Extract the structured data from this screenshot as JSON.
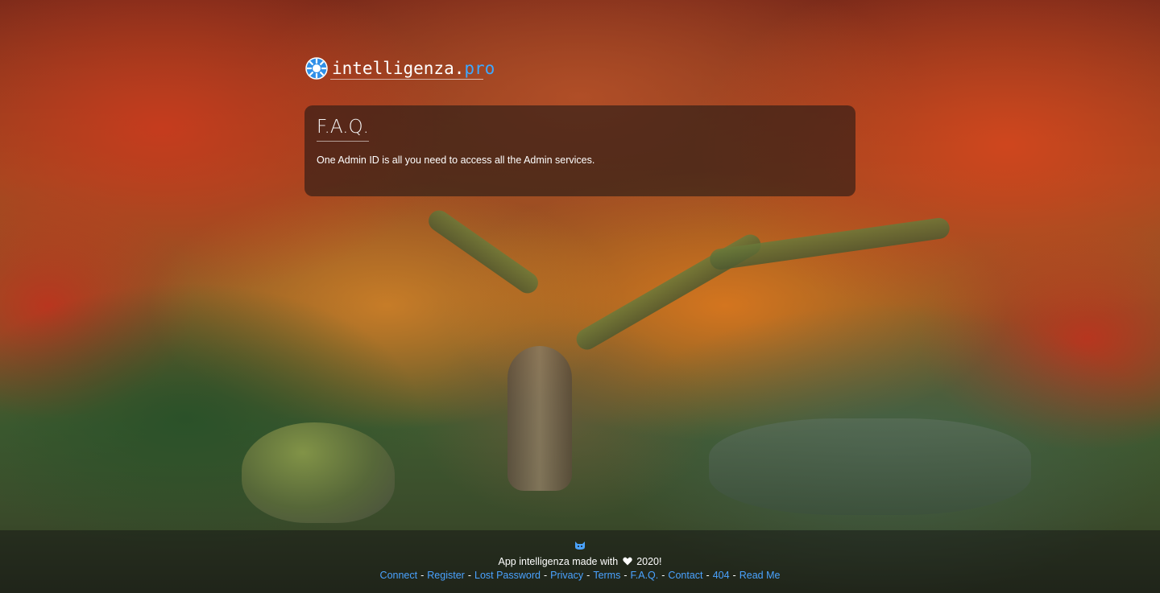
{
  "header": {
    "logo_icon": "gear-globe-icon",
    "logo_text": "intelligenza.",
    "logo_accent": "pro",
    "accent_color": "#3ea8ff"
  },
  "faq": {
    "title": "F.A.Q.",
    "text": "One Admin ID is all you need to access all the Admin services."
  },
  "footer": {
    "icon": "github-cat-icon",
    "made_prefix": "App intelligenza made with",
    "heart_icon": "heart-icon",
    "made_suffix": "2020!",
    "separator": "-",
    "link_color": "#4aa3ff",
    "links": [
      "Connect",
      "Register",
      "Lost Password",
      "Privacy",
      "Terms",
      "F.A.Q.",
      "Contact",
      "404",
      "Read Me"
    ]
  }
}
